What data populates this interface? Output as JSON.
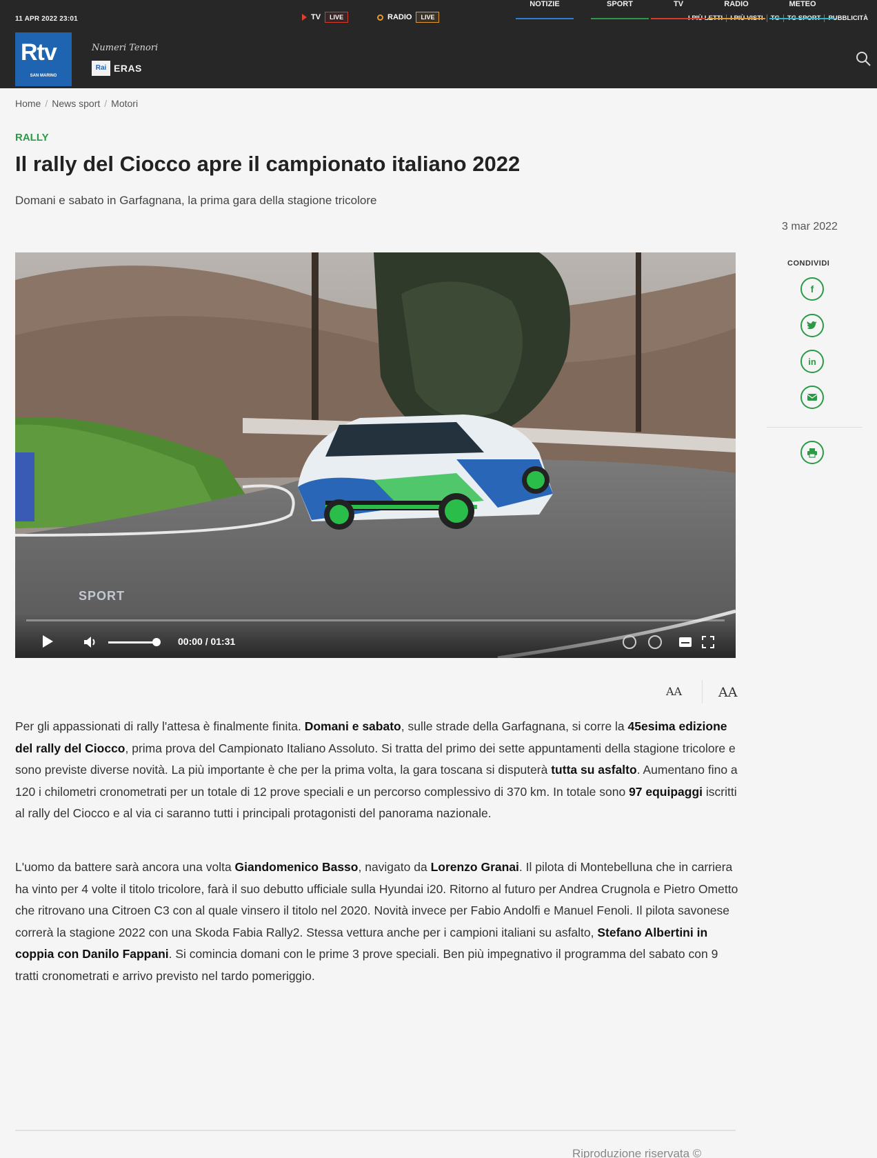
{
  "header": {
    "date": "11 APR 2022 23:01",
    "tv": {
      "label": "TV",
      "badge": "LIVE"
    },
    "radio": {
      "label": "RADIO",
      "badge": "LIVE"
    },
    "top_links": [
      "I PIÙ LETTI",
      "I PIÙ VISTI",
      "TG",
      "TG SPORT",
      "PUBBLICITÀ"
    ],
    "logo": {
      "main": "Rtv",
      "sub": "SAN MARINO"
    },
    "partner": {
      "script": "Numeri Tenori",
      "rai": "Rai",
      "eras": "ERAS"
    },
    "nav": [
      {
        "label": "NOTIZIE",
        "color": "#2a7fd6"
      },
      {
        "label": "SPORT",
        "color": "#2a9a46"
      },
      {
        "label": "TV",
        "color": "#d23a2a"
      },
      {
        "label": "RADIO",
        "color": "#e39a2d"
      },
      {
        "label": "METEO",
        "color": "#2ab6c8"
      }
    ],
    "search_icon": "search-icon"
  },
  "breadcrumb": [
    "Home",
    "News sport",
    "Motori"
  ],
  "article": {
    "category": "RALLY",
    "title": "Il rally del Ciocco apre il campionato italiano 2022",
    "subtitle": "Domani e sabato in Garfagnana, la prima gara della stagione tricolore",
    "date": "3 mar 2022",
    "share_label": "CONDIVIDI",
    "share_icons": [
      "facebook-icon",
      "twitter-icon",
      "linkedin-icon",
      "email-icon",
      "print-icon"
    ],
    "video": {
      "time": "00:00 / 01:31",
      "watermark": "SPORT",
      "progress": 0,
      "volume": 0.9
    },
    "font_controls": [
      "AA",
      "AA"
    ],
    "p1": [
      {
        "t": "Per gli appassionati di rally l'attesa è finalmente finita. "
      },
      {
        "t": "Domani e sabato",
        "b": true
      },
      {
        "t": ", sulle strade della Garfagnana, si corre la "
      },
      {
        "t": "45esima edizione del rally del Ciocco",
        "b": true
      },
      {
        "t": ", prima prova del Campionato Italiano Assoluto. Si tratta del primo dei sette appuntamenti della stagione tricolore e sono previste diverse novità. La più importante è che per la prima volta, la gara toscana si disputerà "
      },
      {
        "t": "tutta su asfalto",
        "b": true
      },
      {
        "t": ". Aumentano fino a 120 i chilometri cronometrati per un totale di 12 prove speciali e un percorso complessivo di 370 km. In totale sono "
      },
      {
        "t": "97 equipaggi",
        "b": true
      },
      {
        "t": " iscritti al rally del Ciocco e al via ci saranno tutti i principali protagonisti del panorama nazionale."
      }
    ],
    "p2": [
      {
        "t": "L'uomo da battere sarà ancora una volta "
      },
      {
        "t": "Giandomenico Basso",
        "b": true
      },
      {
        "t": ", navigato da "
      },
      {
        "t": "Lorenzo Granai",
        "b": true
      },
      {
        "t": ". Il pilota di Montebelluna che in carriera ha vinto per 4 volte il titolo tricolore, farà il suo debutto ufficiale sulla Hyundai i20. Ritorno al futuro per Andrea Crugnola e Pietro Ometto che ritrovano una Citroen C3 con al quale vinsero il titolo nel 2020. Novità invece per Fabio Andolfi e Manuel Fenoli. Il pilota savonese correrà la stagione 2022 con una Skoda Fabia Rally2. Stessa vettura anche per i campioni italiani su asfalto, "
      },
      {
        "t": "Stefano Albertini in coppia con Danilo Fappani",
        "b": true
      },
      {
        "t": ". Si comincia domani con le prime 3 prove speciali. Ben più impegnativo il programma del sabato con 9 tratti cronometrati e arrivo previsto nel tardo pomeriggio."
      }
    ],
    "rights": "Riproduzione riservata ©"
  }
}
